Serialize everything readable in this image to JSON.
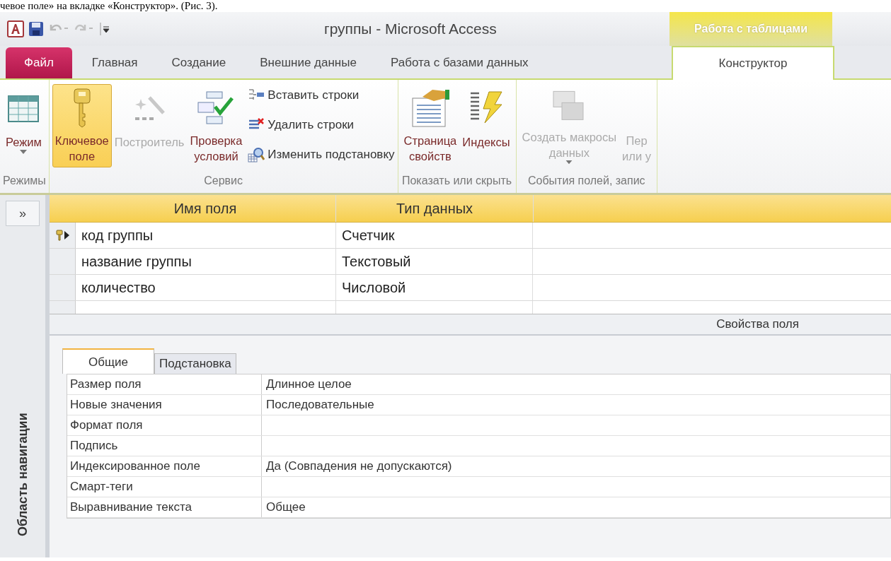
{
  "doc_text": "чевое поле» на вкладке «Конструктор». (Рис. 3).",
  "window": {
    "title": "группы - Microsoft Access",
    "context_group": "Работа с таблицами"
  },
  "tabs": [
    {
      "label": "Файл",
      "kind": "file",
      "selected": false
    },
    {
      "label": "Главная",
      "kind": "normal",
      "selected": false
    },
    {
      "label": "Создание",
      "kind": "normal",
      "selected": false
    },
    {
      "label": "Внешние данные",
      "kind": "normal",
      "selected": false
    },
    {
      "label": "Работа с базами данных",
      "kind": "normal",
      "selected": false
    },
    {
      "label": "Конструктор",
      "kind": "context",
      "selected": true
    }
  ],
  "ribbon": [
    {
      "label": "Режимы",
      "buttons": [
        {
          "kind": "large",
          "lines": [
            "Режим"
          ],
          "dropdown": true,
          "selected": false,
          "disabled": false
        }
      ]
    },
    {
      "label": "Сервис",
      "buttons": [
        {
          "kind": "large",
          "lines": [
            "Ключевое",
            "поле"
          ],
          "dropdown": false,
          "selected": true,
          "disabled": false
        },
        {
          "kind": "large",
          "lines": [
            "Построитель"
          ],
          "dropdown": false,
          "selected": false,
          "disabled": true
        },
        {
          "kind": "large",
          "lines": [
            "Проверка",
            "условий"
          ],
          "dropdown": false,
          "selected": false,
          "disabled": false
        },
        {
          "kind": "small",
          "lines": [
            "Вставить строки"
          ],
          "disabled": false
        },
        {
          "kind": "small",
          "lines": [
            "Удалить строки"
          ],
          "disabled": false
        },
        {
          "kind": "small",
          "lines": [
            "Изменить подстановку"
          ],
          "disabled": false
        }
      ]
    },
    {
      "label": "Показать или скрыть",
      "buttons": [
        {
          "kind": "large",
          "lines": [
            "Страница",
            "свойств"
          ],
          "dropdown": false,
          "selected": false,
          "disabled": false
        },
        {
          "kind": "large",
          "lines": [
            "Индексы"
          ],
          "dropdown": false,
          "selected": false,
          "disabled": false
        }
      ]
    },
    {
      "label": "События полей, запис",
      "buttons": [
        {
          "kind": "large",
          "lines": [
            "Создать макросы",
            "данных"
          ],
          "dropdown": true,
          "selected": false,
          "disabled": true
        },
        {
          "kind": "large",
          "lines": [
            "Пер",
            "или у"
          ],
          "dropdown": false,
          "selected": false,
          "disabled": true
        }
      ]
    }
  ],
  "nav_pane": {
    "toggle": "»",
    "title": "Область навигации"
  },
  "grid": {
    "columns": [
      "Имя поля",
      "Тип данных"
    ],
    "rows": [
      {
        "name": "код группы",
        "type": "Счетчик",
        "primary_key": true,
        "selected": true
      },
      {
        "name": "название группы",
        "type": "Текстовый",
        "primary_key": false,
        "selected": false
      },
      {
        "name": "количество",
        "type": "Числовой",
        "primary_key": false,
        "selected": false
      }
    ]
  },
  "properties": {
    "title": "Свойства поля",
    "tabs": [
      {
        "label": "Общие",
        "selected": true
      },
      {
        "label": "Подстановка",
        "selected": false
      }
    ],
    "rows": [
      {
        "name": "Размер поля",
        "value": "Длинное целое"
      },
      {
        "name": "Новые значения",
        "value": "Последовательные"
      },
      {
        "name": "Формат поля"
      },
      {
        "name": "Подпись"
      },
      {
        "name": "Индексированное поле",
        "value": "Да (Совпадения не допускаются)"
      },
      {
        "name": "Смарт-теги"
      },
      {
        "name": "Выравнивание текста",
        "value": "Общее"
      }
    ]
  }
}
